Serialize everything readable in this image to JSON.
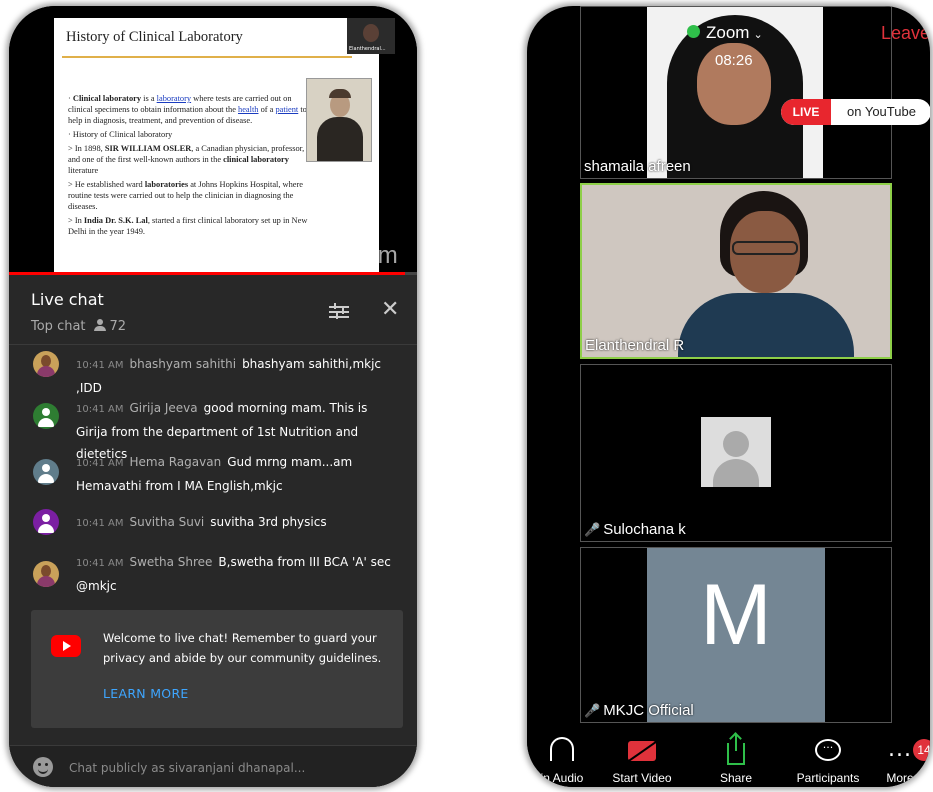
{
  "left": {
    "slide": {
      "title": "History of Clinical Laboratory",
      "p1_a": "Clinical laboratory",
      "p1_b": " is a ",
      "p1_c": "laboratory",
      "p1_d": " where tests are carried out on clinical specimens to obtain information about the ",
      "p1_e": "health",
      "p1_f": " of a ",
      "p1_g": "patient",
      "p1_h": " to help in diagnosis, treatment, and prevention of disease.",
      "p2": "History of Clinical laboratory",
      "p3_a": "In 1898, ",
      "p3_b": "SIR WILLIAM OSLER",
      "p3_c": ", a Canadian physician, professor, and one of the first well-known authors in the ",
      "p3_d": "clinical laboratory",
      "p3_e": " literature",
      "p4_a": "He established ward ",
      "p4_b": "laboratories",
      "p4_c": " at Johns Hopkins Hospital, where routine tests were carried out to help the clinician in diagnosing the diseases.",
      "p5_a": "In ",
      "p5_b": "India Dr. S.K. Lal",
      "p5_c": ", started a first  clinical laboratory set up in New Delhi in the year 1949.",
      "pip_label": "Elanthendral...",
      "watermark": "zoom"
    },
    "progress": 0.97,
    "chat": {
      "title": "Live chat",
      "subtitle": "Top chat",
      "viewers": "72",
      "close": "✕",
      "messages": [
        {
          "time": "10:41 AM",
          "author": "bhashyam sahithi",
          "text": "bhashyam sahithi,mkjc ,IDD",
          "avatar_color": "#c9a15a"
        },
        {
          "time": "10:41 AM",
          "author": "Girija Jeeva",
          "text": "good morning mam. This is Girija from the department of 1st Nutrition and dietetics",
          "avatar_color": "#2e7d32"
        },
        {
          "time": "10:41 AM",
          "author": "Hema Ragavan",
          "text": "Gud mrng mam...am Hemavathi from I MA English,mkjc",
          "avatar_color": "#607d8b"
        },
        {
          "time": "10:41 AM",
          "author": "Suvitha Suvi",
          "text": "suvitha 3rd physics",
          "avatar_color": "#7b1fa2"
        },
        {
          "time": "10:41 AM",
          "author": "Swetha Shree",
          "text": "B,swetha from III BCA 'A' sec @mkjc",
          "avatar_color": "#c9a15a"
        }
      ],
      "notice": "Welcome to live chat! Remember to guard your privacy and abide by our community guidelines.",
      "learn_more": "LEARN MORE",
      "placeholder": "Chat publicly as sivaranjani dhanapal..."
    }
  },
  "right": {
    "app_title": "Zoom",
    "chevron": "⌄",
    "timer": "08:26",
    "leave": "Leave",
    "live_badge": "LIVE",
    "live_text": "on YouTube",
    "tiles": [
      {
        "name": "shamaila afreen",
        "muted": false
      },
      {
        "name": "Elanthendral R",
        "muted": false
      },
      {
        "name": "Sulochana k",
        "muted": true
      },
      {
        "name": "MKJC Official",
        "muted": true,
        "letter": "M"
      }
    ],
    "toolbar": {
      "audio": "in Audio",
      "video": "Start Video",
      "share": "Share",
      "participants": "Participants",
      "more": "More",
      "more_glyph": "...",
      "more_badge": "14",
      "participants_glyph": "···"
    },
    "muted_glyph": "🎤",
    "colors": {
      "live_red": "#e8262e",
      "active_green": "#8ecf48",
      "leave_red": "#e0323b"
    }
  }
}
